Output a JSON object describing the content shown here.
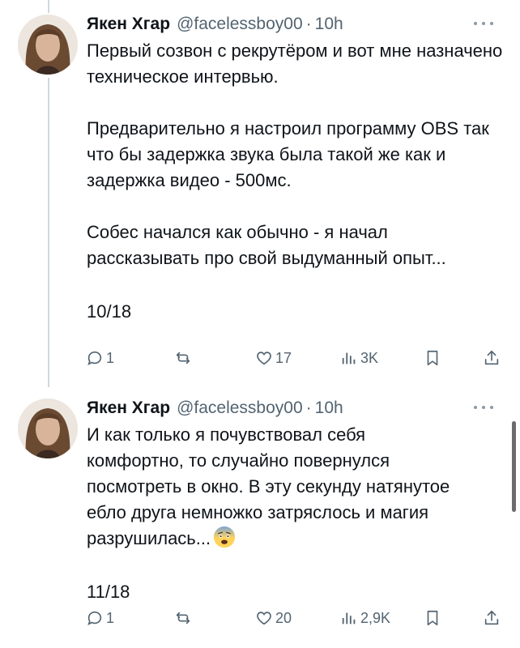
{
  "tweets": [
    {
      "author": {
        "name": "Якен Хгар",
        "handle": "@facelessboy00",
        "time": "10h"
      },
      "separator": "·",
      "paragraphs": [
        "Первый созвон с рекрутёром и вот мне назначено техническое интервью.",
        "Предварительно я настроил программу OBS так что бы задержка звука была такой же как и задержка видео - 500мс.",
        "Собес начался как обычно - я начал рассказывать про свой выдуманный опыт..."
      ],
      "counter": "10/18",
      "stats": {
        "replies": "1",
        "reposts": "",
        "likes": "17",
        "views": "3K"
      }
    },
    {
      "author": {
        "name": "Якен Хгар",
        "handle": "@facelessboy00",
        "time": "10h"
      },
      "separator": "·",
      "paragraphs": [
        "И как только я почувствовал себя комфортно, то случайно повернулся посмотреть в окно. В эту секунду натянутое ебло друга немножко затряслось и магия разрушилась..."
      ],
      "emoji": "fearful-face",
      "counter": "11/18",
      "stats": {
        "replies": "1",
        "reposts": "",
        "likes": "20",
        "views": "2,9K"
      }
    }
  ],
  "colors": {
    "text": "#0f1419",
    "secondary": "#536471",
    "thread_line": "#cfd9de",
    "background": "#ffffff"
  },
  "icons": [
    "avatar",
    "more-icon",
    "reply-icon",
    "repost-icon",
    "like-icon",
    "views-icon",
    "bookmark-icon",
    "share-icon",
    "fearful-face-emoji"
  ]
}
